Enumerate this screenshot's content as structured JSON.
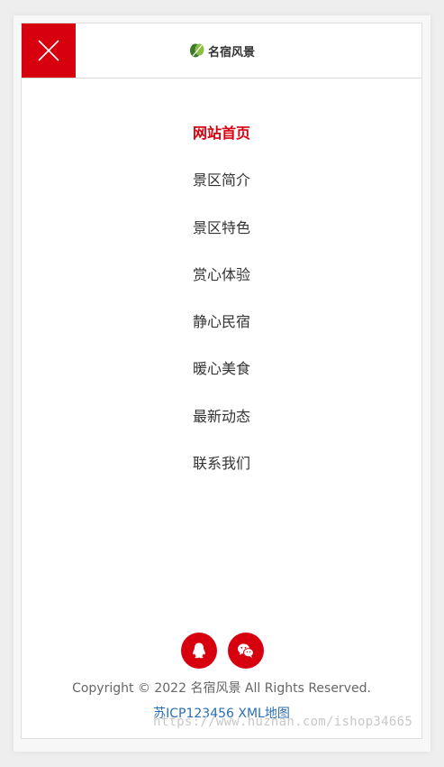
{
  "header": {
    "logo_text": "名宿风景",
    "close_icon": "close-icon"
  },
  "nav": {
    "items": [
      {
        "label": "网站首页",
        "active": true
      },
      {
        "label": "景区简介",
        "active": false
      },
      {
        "label": "景区特色",
        "active": false
      },
      {
        "label": "赏心体验",
        "active": false
      },
      {
        "label": "静心民宿",
        "active": false
      },
      {
        "label": "暖心美食",
        "active": false
      },
      {
        "label": "最新动态",
        "active": false
      },
      {
        "label": "联系我们",
        "active": false
      }
    ]
  },
  "footer": {
    "social_icons": [
      "qq-icon",
      "wechat-icon"
    ],
    "copyright": "Copyright © 2022 名宿风景 All Rights Reserved.",
    "icp": "苏ICP123456",
    "sitemap": "XML地图"
  },
  "watermark": "https://www.huzhan.com/ishop34665",
  "colors": {
    "accent": "#d7000f",
    "text": "#333333",
    "link": "#2a6fb4"
  }
}
